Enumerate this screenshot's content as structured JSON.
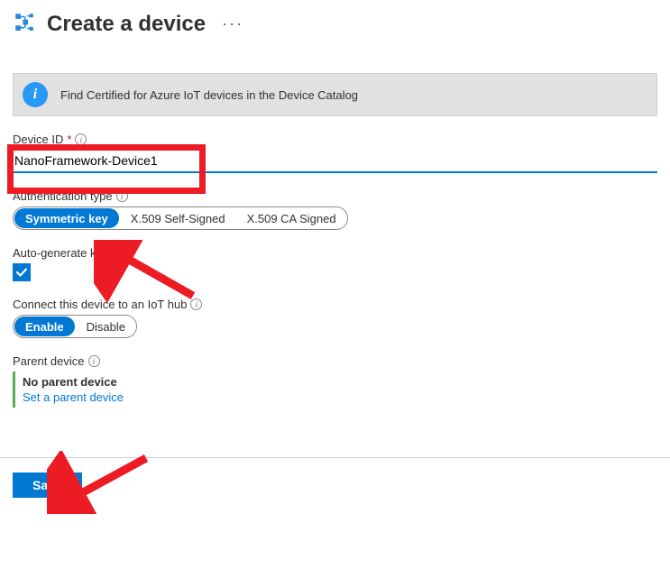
{
  "header": {
    "title": "Create a device",
    "more_label": "···"
  },
  "info": {
    "text": "Find Certified for Azure IoT devices in the Device Catalog"
  },
  "device_id": {
    "label": "Device ID",
    "required_mark": "*",
    "value": "NanoFramework-Device1"
  },
  "auth_type": {
    "label": "Authentication type",
    "options": [
      "Symmetric key",
      "X.509 Self-Signed",
      "X.509 CA Signed"
    ],
    "selected_index": 0
  },
  "autogen": {
    "label": "Auto-generate keys",
    "checked": true
  },
  "connect_hub": {
    "label": "Connect this device to an IoT hub",
    "options": [
      "Enable",
      "Disable"
    ],
    "selected_index": 0
  },
  "parent": {
    "label": "Parent device",
    "none_text": "No parent device",
    "link_text": "Set a parent device"
  },
  "footer": {
    "save_label": "Save"
  },
  "colors": {
    "primary": "#0078d4",
    "annotation_red": "#ed1c24"
  }
}
